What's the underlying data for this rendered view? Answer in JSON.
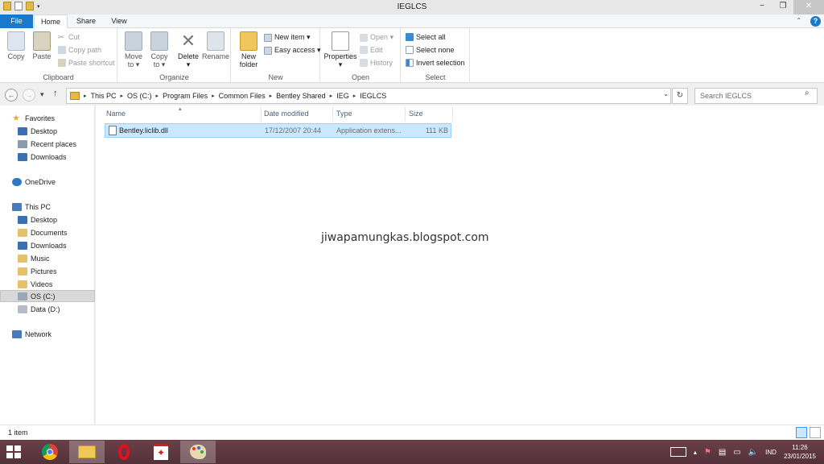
{
  "window": {
    "title": "IEGLCS",
    "minimize": "−",
    "maximize": "❐",
    "close": "✕"
  },
  "tabs": {
    "file": "File",
    "home": "Home",
    "share": "Share",
    "view": "View",
    "help": "?",
    "collapse": "⌃"
  },
  "ribbon": {
    "clipboard": {
      "label": "Clipboard",
      "copy": "Copy",
      "paste": "Paste",
      "cut": "Cut",
      "copy_path": "Copy path",
      "paste_shortcut": "Paste shortcut"
    },
    "organize": {
      "label": "Organize",
      "move_to": "Move",
      "move_to_2": "to ▾",
      "copy_to": "Copy",
      "copy_to_2": "to ▾",
      "delete": "Delete",
      "delete_2": "▾",
      "rename": "Rename"
    },
    "new": {
      "label": "New",
      "new_folder": "New",
      "new_folder_2": "folder",
      "new_item": "New item ▾",
      "easy_access": "Easy access ▾"
    },
    "open": {
      "label": "Open",
      "properties": "Properties",
      "properties_2": "▾",
      "open": "Open ▾",
      "edit": "Edit",
      "history": "History"
    },
    "select": {
      "label": "Select",
      "select_all": "Select all",
      "select_none": "Select none",
      "invert_selection": "Invert selection"
    }
  },
  "nav": {
    "back": "←",
    "forward": "→",
    "recent": "▾",
    "up": "↑",
    "breadcrumb": [
      "This PC",
      "OS (C:)",
      "Program Files",
      "Common Files",
      "Bentley Shared",
      "IEG",
      "IEGLCS"
    ],
    "refresh": "↻",
    "search_placeholder": "Search IEGLCS"
  },
  "sidebar": {
    "favorites": "Favorites",
    "favorites_items": [
      "Desktop",
      "Recent places",
      "Downloads"
    ],
    "onedrive": "OneDrive",
    "this_pc": "This PC",
    "this_pc_items": [
      "Desktop",
      "Documents",
      "Downloads",
      "Music",
      "Pictures",
      "Videos",
      "OS (C:)",
      "Data (D:)"
    ],
    "network": "Network"
  },
  "columns": {
    "name": "Name",
    "date_modified": "Date modified",
    "type": "Type",
    "size": "Size"
  },
  "files": [
    {
      "name": "Bentley.liclib.dll",
      "date_modified": "17/12/2007 20:44",
      "type": "Application extens...",
      "size": "111 KB"
    }
  ],
  "watermark": "jiwapamungkas.blogspot.com",
  "status": {
    "item_count": "1 item"
  },
  "taskbar": {
    "apps": [
      "chrome-icon",
      "file-explorer-icon",
      "opera-icon",
      "acrobat-icon",
      "paint-icon"
    ],
    "language": "IND",
    "time": "11:26",
    "date": "23/01/2015"
  },
  "colors": {
    "accent": "#1979ca",
    "selection": "#cce8ff",
    "taskbar": "#5e3840"
  }
}
